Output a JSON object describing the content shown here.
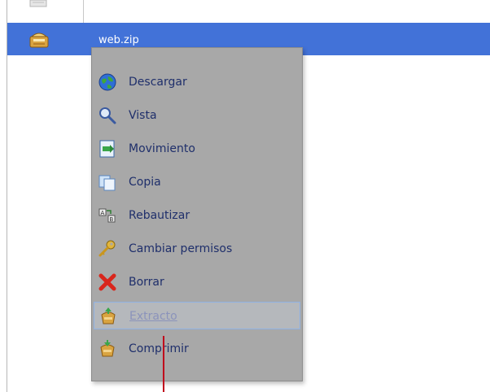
{
  "file_row": {
    "name": "web.zip"
  },
  "context_menu": {
    "items": [
      {
        "label": "Descargar",
        "icon": "globe-download-icon"
      },
      {
        "label": "Vista",
        "icon": "magnifier-icon"
      },
      {
        "label": "Movimiento",
        "icon": "move-file-icon"
      },
      {
        "label": "Copia",
        "icon": "copy-icon"
      },
      {
        "label": "Rebautizar",
        "icon": "rename-icon"
      },
      {
        "label": "Cambiar permisos",
        "icon": "key-icon"
      },
      {
        "label": "Borrar",
        "icon": "delete-x-icon"
      },
      {
        "label": "Extracto",
        "icon": "extract-archive-icon",
        "state": "disabled-focused"
      },
      {
        "label": "Comprimir",
        "icon": "compress-archive-icon"
      }
    ]
  },
  "colors": {
    "selection": "#4272d8",
    "menu_background": "#a8a8a8",
    "menu_text": "#1f2f6b",
    "cursor": "#c0001c"
  }
}
